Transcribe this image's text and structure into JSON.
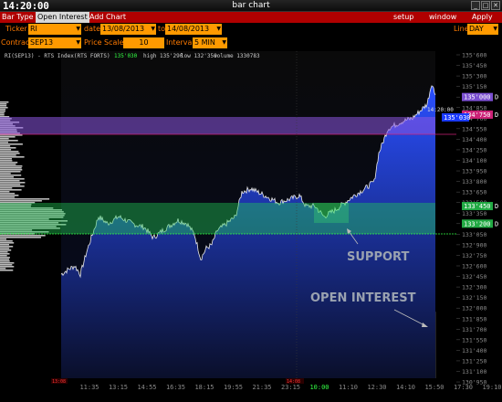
{
  "window": {
    "clock": "14:20:00",
    "title": "bar chart",
    "min_icon": "minimize-icon",
    "max_icon": "maximize-icon",
    "close_icon": "close-icon"
  },
  "menu": {
    "bar_type": "Bar Type",
    "open_interest": "Open Interest",
    "add_chart": "Add Chart",
    "setup": "setup",
    "window": "window",
    "apply": "Apply"
  },
  "form": {
    "ticker_label": "Ticker",
    "ticker": "RI",
    "date_label": "date",
    "date_from": "13/08/2013",
    "to_label": "to",
    "date_to": "14/08/2013",
    "line_label": "Line",
    "line": "DAY",
    "contract_label": "Contract",
    "contract": "SEP13",
    "price_scale_label": "Price Scale",
    "price_scale": "10",
    "interval_label": "Interval",
    "interval": "5 MIN"
  },
  "chart_data": {
    "type": "area",
    "header": "RI(SEP13) - RTS Index(RTS FORTS)",
    "last": "135'030",
    "high": "high 135'290",
    "low": "low 132'350",
    "volume": "volume 1330783",
    "y_ticks": [
      "135'600",
      "135'450",
      "135'300",
      "135'150",
      "135'000",
      "134'850",
      "134'700",
      "134'550",
      "134'400",
      "134'250",
      "134'100",
      "133'950",
      "133'800",
      "133'650",
      "133'500",
      "133'350",
      "133'200",
      "133'050",
      "132'900",
      "132'750",
      "132'600",
      "132'450",
      "132'300",
      "132'150",
      "132'000",
      "131'850",
      "131'700",
      "131'550",
      "131'400",
      "131'250",
      "131'100",
      "130'950"
    ],
    "x_ticks": [
      "11:35",
      "13:15",
      "14:55",
      "16:35",
      "18:15",
      "19:55",
      "21:35",
      "23:15",
      "10:00",
      "11:10",
      "12:30",
      "14:10",
      "15:50",
      "17:30",
      "19:10"
    ],
    "day_tag_left": "13:08",
    "day_tag_mid": "14:08",
    "cursor_time": "14:20:00",
    "levels": [
      {
        "value": "135'000",
        "tag": "D",
        "color": "#7a4fd0"
      },
      {
        "value": "134'750",
        "tag": "D",
        "color": "#cc2277"
      },
      {
        "value": "133'450",
        "tag": "D",
        "color": "#22aa44"
      },
      {
        "value": "133'200",
        "tag": "D",
        "color": "#22aa44"
      }
    ],
    "last_price_tag": "135'030",
    "annotations": {
      "support": "SUPPORT",
      "open_interest": "OPEN INTEREST"
    },
    "colors": {
      "price_area_top": "#2a4fff",
      "oi_bars": "#aaaaaa",
      "zone_resistance": "#7a4fd0",
      "zone_support": "#22aa55",
      "accent": "#ff9a00"
    }
  }
}
